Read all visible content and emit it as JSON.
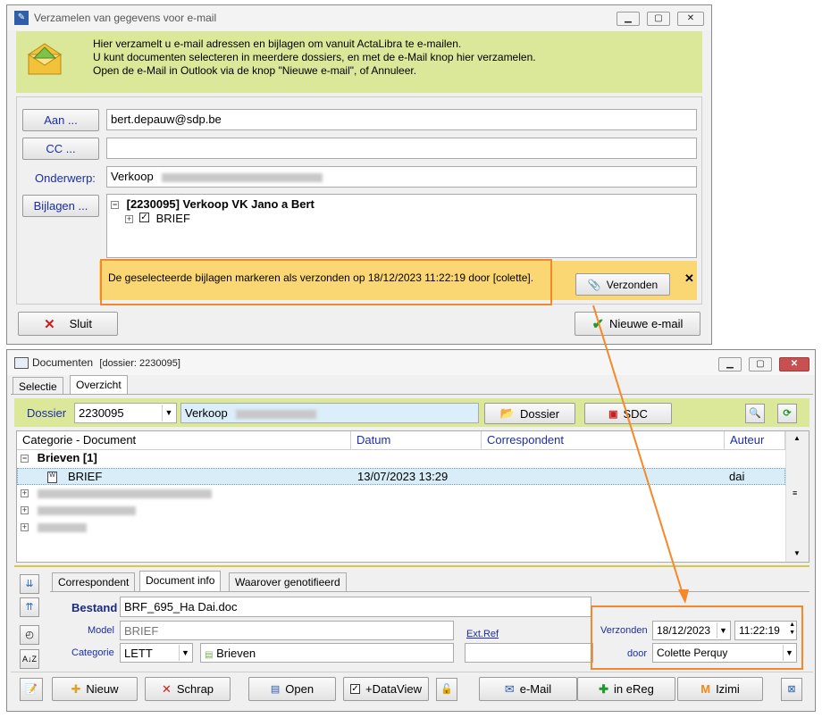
{
  "email_window": {
    "title": "Verzamelen van gegevens voor e-mail",
    "info_lines": [
      "Hier verzamelt u e-mail adressen en bijlagen om vanuit ActaLibra te e-mailen.",
      "U kunt documenten selecteren in meerdere dossiers, en met de e-Mail knop hier verzamelen.",
      "Open de e-Mail in Outlook via de knop \"Nieuwe e-mail\", of Annuleer."
    ],
    "to_button": "Aan ...",
    "to_value": "bert.depauw@sdp.be",
    "cc_button": "CC ...",
    "cc_value": "",
    "subject_label": "Onderwerp:",
    "subject_value": "Verkoop",
    "attachments_button": "Bijlagen ...",
    "tree_root": "[2230095] Verkoop VK Jano a Bert",
    "tree_child": "BRIEF",
    "notice": "De geselecteerde bijlagen markeren als verzonden op 18/12/2023 11:22:19 door [colette].",
    "send_button": "Verzonden",
    "close_button": "Sluit",
    "new_email_button": "Nieuwe e-mail"
  },
  "docs_window": {
    "title": "Documenten",
    "title_suffix": "[dossier: 2230095]",
    "tabs": [
      "Selectie",
      "Overzicht"
    ],
    "dossier_label": "Dossier",
    "dossier_value": "2230095",
    "dossier_desc": "Verkoop",
    "dossier_button": "Dossier",
    "sdc_button": "SDC",
    "columns": [
      "Categorie - Document",
      "Datum",
      "Correspondent",
      "Auteur"
    ],
    "group": "Brieven [1]",
    "doc_row": {
      "name": "BRIEF",
      "date": "13/07/2023 13:29",
      "author": "dai"
    },
    "detail_tabs": [
      "Correspondent",
      "Document info",
      "Waarover genotifieerd"
    ],
    "file_label": "Bestand",
    "file_value": "BRF_695_Ha Dai.doc",
    "model_label": "Model",
    "model_value": "BRIEF",
    "category_label": "Categorie",
    "category_value": "LETT",
    "category_desc": "Brieven",
    "extref_label": "Ext.Ref",
    "sent_label": "Verzonden",
    "sent_date": "18/12/2023",
    "sent_time": "11:22:19",
    "by_label": "door",
    "by_value": "Colette Perquy",
    "toolbar": {
      "new": "Nieuw",
      "delete": "Schrap",
      "open": "Open",
      "dataview": "+DataView",
      "email": "e-Mail",
      "ereg": "in eReg",
      "izimi": "Izimi"
    }
  },
  "colors": {
    "accent_orange": "#f5882a",
    "info_band": "#dbe89a",
    "notice_band": "#fbd773"
  }
}
